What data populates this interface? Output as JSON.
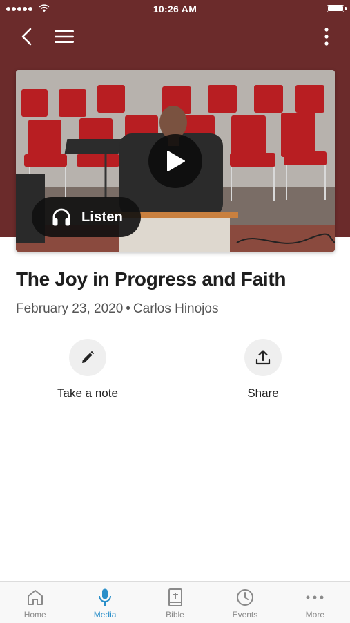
{
  "status_bar": {
    "time": "10:26 AM"
  },
  "colors": {
    "header": "#6b2b2b",
    "accent": "#2a8fc9",
    "tab_inactive": "#8a8a8a"
  },
  "nav": {
    "icons": [
      "back-icon",
      "hamburger-menu-icon",
      "more-vertical-icon"
    ]
  },
  "media": {
    "listen_label": "Listen"
  },
  "sermon": {
    "title": "The Joy in Progress and Faith",
    "date": "February 23, 2020",
    "separator": "•",
    "speaker": "Carlos Hinojos"
  },
  "actions": [
    {
      "label": "Take a note",
      "icon": "pencil-icon"
    },
    {
      "label": "Share",
      "icon": "share-icon"
    }
  ],
  "tabs": [
    {
      "label": "Home",
      "icon": "home-icon",
      "active": false
    },
    {
      "label": "Media",
      "icon": "microphone-icon",
      "active": true
    },
    {
      "label": "Bible",
      "icon": "bible-icon",
      "active": false
    },
    {
      "label": "Events",
      "icon": "clock-icon",
      "active": false
    },
    {
      "label": "More",
      "icon": "more-horizontal-icon",
      "active": false
    }
  ]
}
